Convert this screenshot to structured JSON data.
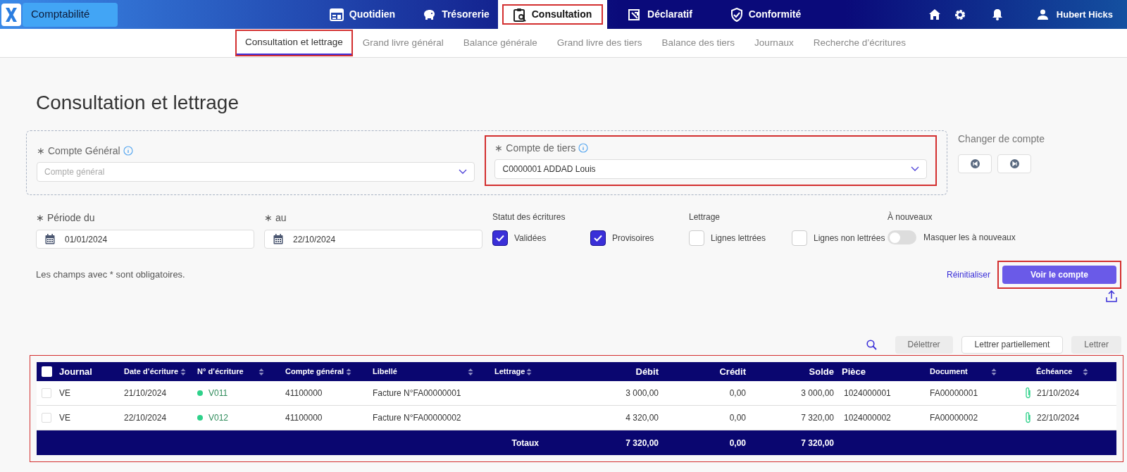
{
  "app": {
    "name": "Comptabilité"
  },
  "nav": [
    {
      "label": "Quotidien",
      "selected": false,
      "highlighted": false
    },
    {
      "label": "Trésorerie",
      "selected": false,
      "highlighted": false
    },
    {
      "label": "Consultation",
      "selected": true,
      "highlighted": true
    },
    {
      "label": "Déclaratif",
      "selected": false,
      "highlighted": false
    },
    {
      "label": "Conformité",
      "selected": false,
      "highlighted": false
    }
  ],
  "user": {
    "name": "Hubert Hicks"
  },
  "subnav": [
    {
      "label": "Consultation et lettrage",
      "selected": true,
      "highlighted": true
    },
    {
      "label": "Grand livre général",
      "selected": false,
      "highlighted": false
    },
    {
      "label": "Balance générale",
      "selected": false,
      "highlighted": false
    },
    {
      "label": "Grand livre des tiers",
      "selected": false,
      "highlighted": false
    },
    {
      "label": "Balance des tiers",
      "selected": false,
      "highlighted": false
    },
    {
      "label": "Journaux",
      "selected": false,
      "highlighted": false
    },
    {
      "label": "Recherche d’écritures",
      "selected": false,
      "highlighted": false
    }
  ],
  "page_title": "Consultation et lettrage",
  "account": {
    "general": {
      "label": "∗ Compte Général",
      "placeholder": "Compte général"
    },
    "tiers": {
      "label": "∗ Compte de tiers",
      "value": "C0000001 ADDAD Louis",
      "highlighted": true
    },
    "change_label": "Changer de compte"
  },
  "period": {
    "from": {
      "label": "∗ Période du",
      "value": "01/01/2024"
    },
    "to": {
      "label": "∗ au",
      "value": "22/10/2024"
    }
  },
  "status": {
    "label": "Statut des écritures",
    "options": [
      {
        "label": "Validées",
        "checked": true
      },
      {
        "label": "Provisoires",
        "checked": true
      }
    ]
  },
  "lettrage": {
    "label": "Lettrage",
    "options": [
      {
        "label": "Lignes lettrées",
        "checked": false
      },
      {
        "label": "Lignes non lettrées",
        "checked": false
      }
    ]
  },
  "a_nouveaux": {
    "label": "À nouveaux",
    "toggle": {
      "label": "Masquer les à nouveaux",
      "on": false
    }
  },
  "required_note": "Les champs avec * sont obligatoires.",
  "reset": "Réinitialiser",
  "submit": {
    "label": "Voir le compte",
    "highlighted": true
  },
  "table_actions": [
    {
      "label": "Délettrer",
      "disabled": true
    },
    {
      "label": "Lettrer partiellement",
      "disabled": false
    },
    {
      "label": "Lettrer",
      "disabled": true
    }
  ],
  "table": {
    "highlighted": true,
    "select_all": false,
    "columns": [
      {
        "label": "Journal",
        "sortable": false,
        "kind": "text"
      },
      {
        "label": "Date d’écriture",
        "sortable": true,
        "kind": "text"
      },
      {
        "label": "N° d’écriture",
        "sortable": true,
        "kind": "text"
      },
      {
        "label": "Compte général",
        "sortable": true,
        "kind": "text"
      },
      {
        "label": "Libellé",
        "sortable": true,
        "kind": "text"
      },
      {
        "label": "Lettrage",
        "sortable": true,
        "kind": "text"
      },
      {
        "label": "Débit",
        "sortable": false,
        "kind": "amount"
      },
      {
        "label": "Crédit",
        "sortable": false,
        "kind": "amount"
      },
      {
        "label": "Solde",
        "sortable": false,
        "kind": "amount"
      },
      {
        "label": "Pièce",
        "sortable": false,
        "kind": "text"
      },
      {
        "label": "Document",
        "sortable": true,
        "kind": "text"
      },
      {
        "label": "Échéance",
        "sortable": true,
        "kind": "text"
      }
    ],
    "rows": [
      {
        "selected": false,
        "journal": "VE",
        "date": "21/10/2024",
        "number": "V011",
        "color": "#2ed18a",
        "account": "41100000",
        "label": "Facture N°FA00000001",
        "debit": "3 000,00",
        "credit": "0,00",
        "balance": "3 000,00",
        "piece": "1024000001",
        "document": "FA00000001",
        "attachment": true,
        "due": "21/10/2024"
      },
      {
        "selected": false,
        "journal": "VE",
        "date": "22/10/2024",
        "number": "V012",
        "color": "#2ed18a",
        "account": "41100000",
        "label": "Facture N°FA00000002",
        "debit": "4 320,00",
        "credit": "0,00",
        "balance": "7 320,00",
        "piece": "1024000002",
        "document": "FA00000002",
        "attachment": true,
        "due": "22/10/2024"
      }
    ],
    "totals": {
      "label": "Totaux",
      "debit": "7 320,00",
      "credit": "0,00",
      "balance": "7 320,00"
    }
  }
}
